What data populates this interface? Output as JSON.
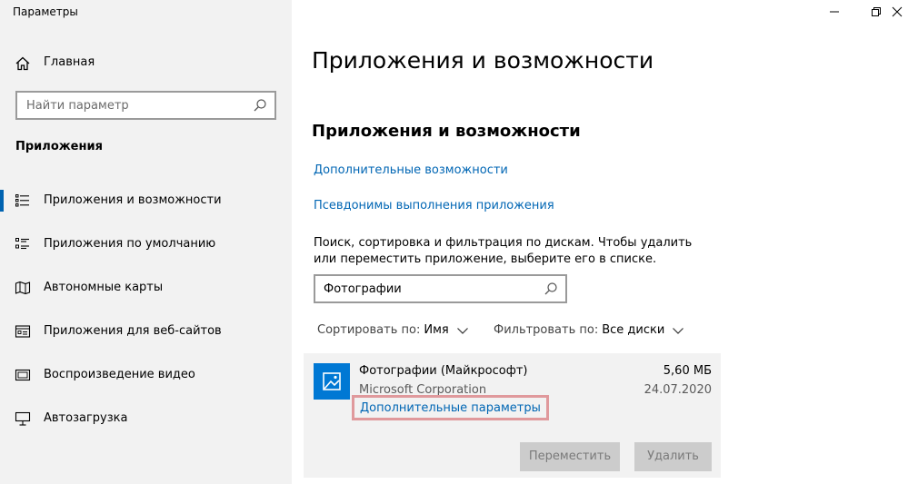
{
  "window": {
    "title": "Параметры"
  },
  "sidebar": {
    "home_label": "Главная",
    "search_placeholder": "Найти параметр",
    "section_title": "Приложения",
    "items": [
      {
        "label": "Приложения и возможности",
        "icon": "apps-features-icon",
        "active": true
      },
      {
        "label": "Приложения по умолчанию",
        "icon": "default-apps-icon",
        "active": false
      },
      {
        "label": "Автономные карты",
        "icon": "offline-maps-icon",
        "active": false
      },
      {
        "label": "Приложения для веб-сайтов",
        "icon": "apps-for-websites-icon",
        "active": false
      },
      {
        "label": "Воспроизведение видео",
        "icon": "video-playback-icon",
        "active": false
      },
      {
        "label": "Автозагрузка",
        "icon": "startup-icon",
        "active": false
      }
    ]
  },
  "main": {
    "page_title": "Приложения и возможности",
    "section_title": "Приложения и возможности",
    "links": {
      "optional_features": "Дополнительные возможности",
      "app_aliases": "Псевдонимы выполнения приложения"
    },
    "description": "Поиск, сортировка и фильтрация по дискам. Чтобы удалить или переместить приложение, выберите его в списке.",
    "search_value": "Фотографии",
    "sort": {
      "label": "Сортировать по:",
      "value": "Имя"
    },
    "filter": {
      "label": "Фильтровать по:",
      "value": "Все диски"
    },
    "app": {
      "name": "Фотографии (Майкрософт)",
      "publisher": "Microsoft Corporation",
      "size": "5,60 МБ",
      "date": "24.07.2020",
      "advanced_link": "Дополнительные параметры",
      "move_label": "Переместить",
      "uninstall_label": "Удалить",
      "icon": "photos-app-icon"
    }
  },
  "colors": {
    "accent": "#0078d4",
    "link": "#0066b4",
    "highlight": "#e0999c",
    "sidebar_bg": "#f2f2f2"
  }
}
